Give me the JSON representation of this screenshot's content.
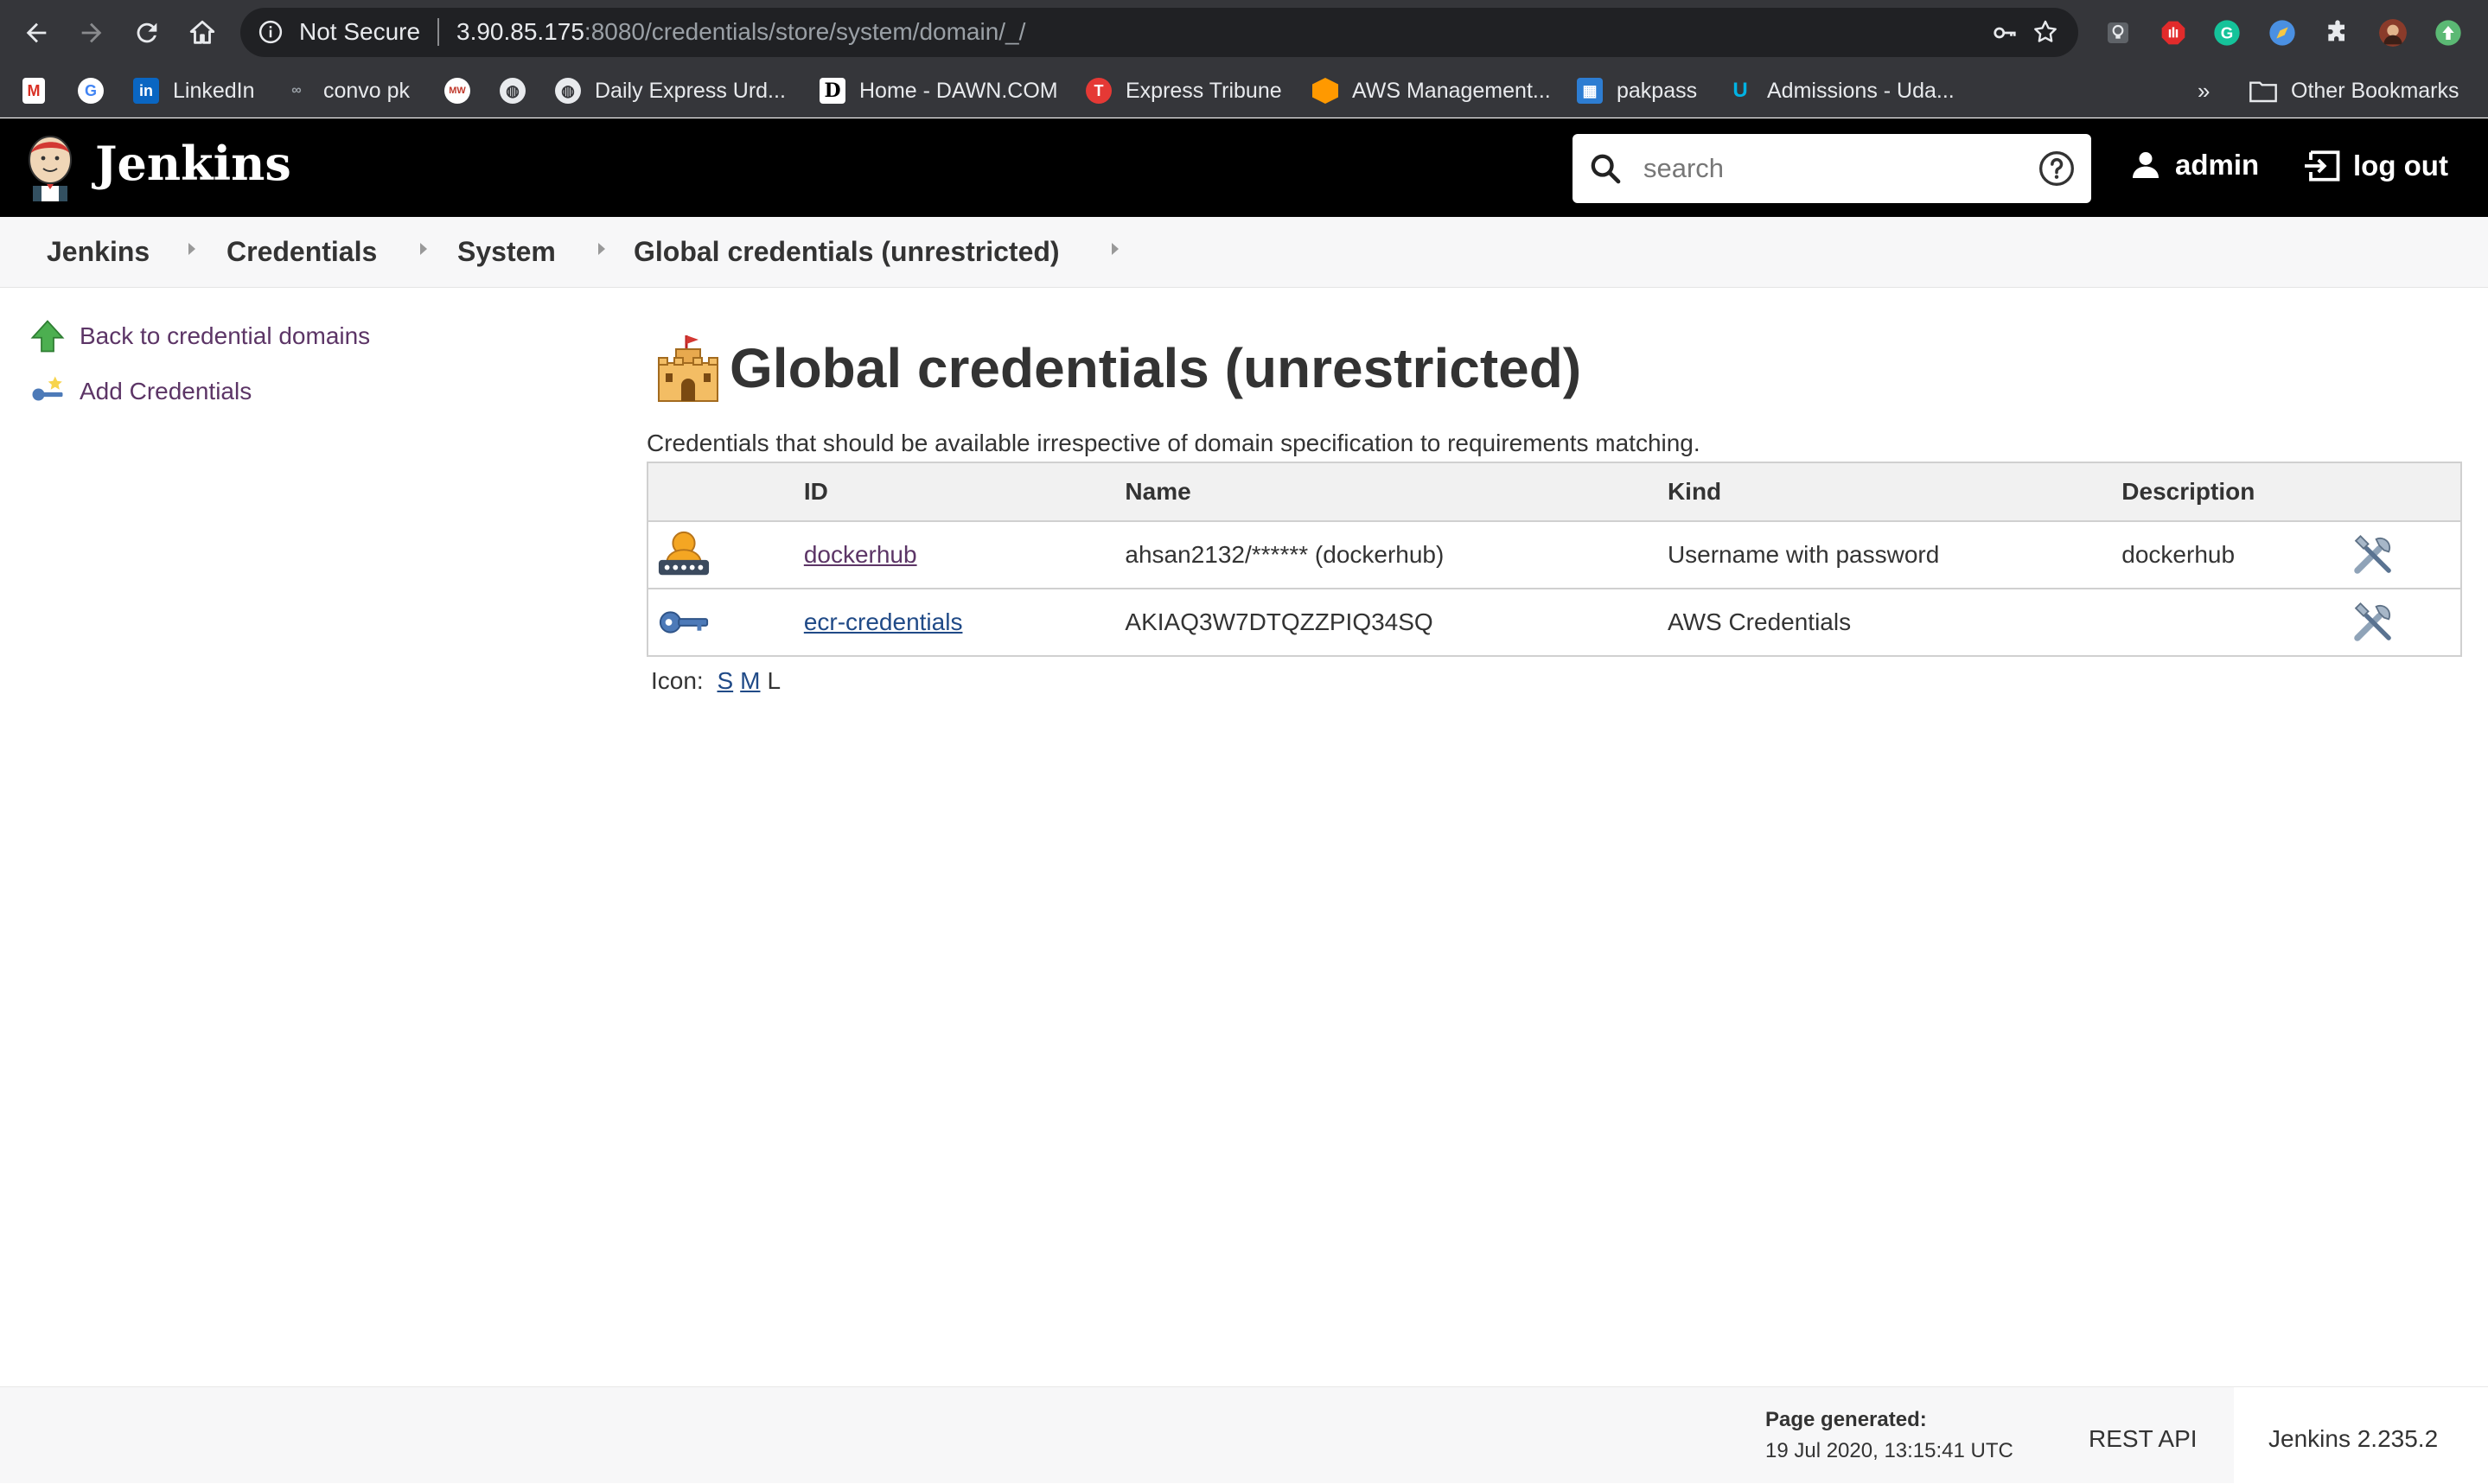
{
  "browser": {
    "security_label": "Not Secure",
    "url_host": "3.90.85.175",
    "url_rest": ":8080/credentials/store/system/domain/_/",
    "bookmarks": [
      {
        "label": "",
        "icon": "gmail-icon"
      },
      {
        "label": "",
        "icon": "google-icon"
      },
      {
        "label": "LinkedIn",
        "icon": "linkedin-icon"
      },
      {
        "label": "convo pk",
        "icon": "convo-icon"
      },
      {
        "label": "",
        "icon": "mw-icon"
      },
      {
        "label": "",
        "icon": "globe-icon"
      },
      {
        "label": "Daily Express Urd...",
        "icon": "globe-icon"
      },
      {
        "label": "Home - DAWN.COM",
        "icon": "dawn-icon"
      },
      {
        "label": "Express Tribune",
        "icon": "tribune-icon"
      },
      {
        "label": "AWS Management...",
        "icon": "aws-icon"
      },
      {
        "label": "pakpass",
        "icon": "pakpass-icon"
      },
      {
        "label": "Admissions - Uda...",
        "icon": "udacity-icon"
      }
    ],
    "overflow": "»",
    "other_bookmarks": "Other Bookmarks"
  },
  "header": {
    "title": "Jenkins",
    "search_placeholder": "search",
    "user": "admin",
    "logout": "log out"
  },
  "breadcrumb": [
    "Jenkins",
    "Credentials",
    "System",
    "Global credentials (unrestricted)"
  ],
  "sidebar": {
    "back": "Back to credential domains",
    "add": "Add Credentials"
  },
  "main": {
    "title": "Global credentials (unrestricted)",
    "description": "Credentials that should be available irrespective of domain specification to requirements matching.",
    "columns": [
      "ID",
      "Name",
      "Kind",
      "Description"
    ],
    "rows": [
      {
        "id": "dockerhub",
        "name": "ahsan2132/****** (dockerhub)",
        "kind": "Username with password",
        "description": "dockerhub",
        "icon": "user-password-icon"
      },
      {
        "id": "ecr-credentials",
        "name": "AKIAQ3W7DTQZZPIQ34SQ",
        "kind": "AWS Credentials",
        "description": "",
        "icon": "key-icon"
      }
    ],
    "icon_label": "Icon:",
    "icon_sizes": [
      "S",
      "M",
      "L"
    ]
  },
  "footer": {
    "generated_label": "Page generated:",
    "generated_time": "19 Jul 2020, 13:15:41 UTC",
    "rest_api": "REST API",
    "version": "Jenkins 2.235.2"
  }
}
